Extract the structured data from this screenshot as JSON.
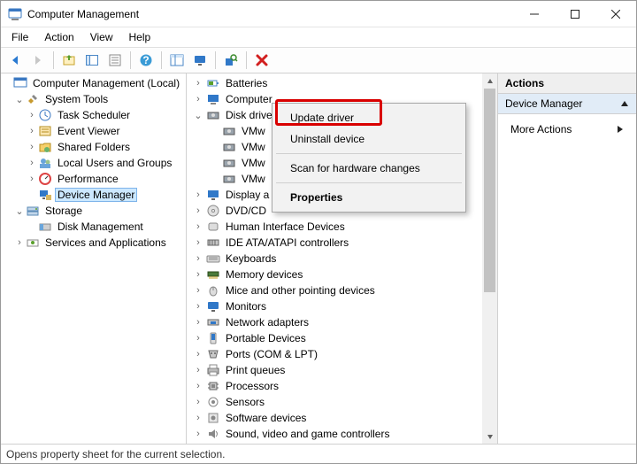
{
  "window": {
    "title": "Computer Management"
  },
  "menu": {
    "file": "File",
    "action": "Action",
    "view": "View",
    "help": "Help"
  },
  "left_tree": {
    "root": "Computer Management (Local)",
    "system_tools": "System Tools",
    "task_scheduler": "Task Scheduler",
    "event_viewer": "Event Viewer",
    "shared_folders": "Shared Folders",
    "local_users_groups": "Local Users and Groups",
    "performance": "Performance",
    "device_manager": "Device Manager",
    "storage": "Storage",
    "disk_management": "Disk Management",
    "services_apps": "Services and Applications"
  },
  "mid": {
    "batteries": "Batteries",
    "computer": "Computer",
    "disk_drives": "Disk drives",
    "vmw1": "VMw",
    "vmw2": "VMw",
    "vmw3": "VMw",
    "vmw4": "VMw",
    "display_adapters": "Display a",
    "dvd_cd": "DVD/CD",
    "hid": "Human Interface Devices",
    "ide": "IDE ATA/ATAPI controllers",
    "keyboards": "Keyboards",
    "memory": "Memory devices",
    "mice": "Mice and other pointing devices",
    "monitors": "Monitors",
    "network": "Network adapters",
    "portable": "Portable Devices",
    "ports": "Ports (COM & LPT)",
    "print_queues": "Print queues",
    "processors": "Processors",
    "sensors": "Sensors",
    "software": "Software devices",
    "sound": "Sound, video and game controllers"
  },
  "context_menu": {
    "update_driver": "Update driver",
    "uninstall": "Uninstall device",
    "scan": "Scan for hardware changes",
    "properties": "Properties"
  },
  "actions": {
    "header": "Actions",
    "device_manager": "Device Manager",
    "more_actions": "More Actions"
  },
  "status": "Opens property sheet for the current selection."
}
